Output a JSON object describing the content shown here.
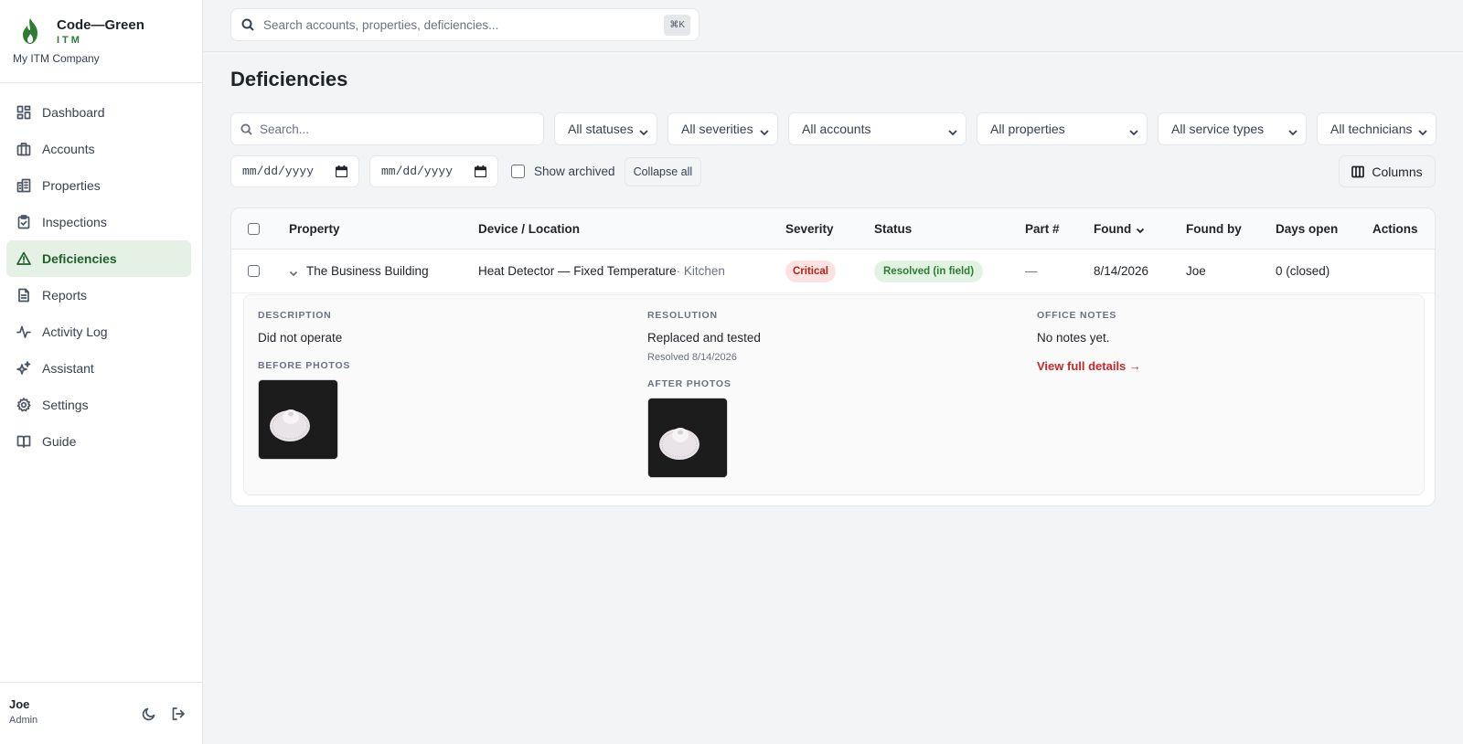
{
  "brand": {
    "name": "Code—Green",
    "sub": "ITM",
    "company": "My ITM Company"
  },
  "nav": [
    {
      "label": "Dashboard",
      "icon": "dashboard-icon"
    },
    {
      "label": "Accounts",
      "icon": "briefcase-icon"
    },
    {
      "label": "Properties",
      "icon": "building-icon"
    },
    {
      "label": "Inspections",
      "icon": "clipboard-check-icon"
    },
    {
      "label": "Deficiencies",
      "icon": "warning-triangle-icon",
      "active": true
    },
    {
      "label": "Reports",
      "icon": "document-icon"
    },
    {
      "label": "Activity Log",
      "icon": "activity-icon"
    },
    {
      "label": "Assistant",
      "icon": "sparkles-icon"
    },
    {
      "label": "Settings",
      "icon": "gear-icon"
    },
    {
      "label": "Guide",
      "icon": "book-icon"
    }
  ],
  "user": {
    "name": "Joe",
    "role": "Admin"
  },
  "topbar": {
    "search_placeholder": "Search accounts, properties, deficiencies...",
    "shortcut": "⌘K"
  },
  "page": {
    "title": "Deficiencies"
  },
  "filters": {
    "search_placeholder": "Search...",
    "status": "All statuses",
    "severity": "All severities",
    "account": "All accounts",
    "property": "All properties",
    "service_type": "All service types",
    "technician": "All technicians",
    "date_from": "mm/dd/yyyy",
    "date_to": "mm/dd/yyyy",
    "show_archived": "Show archived",
    "collapse_all": "Collapse all",
    "columns": "Columns"
  },
  "table": {
    "headers": {
      "property": "Property",
      "device": "Device / Location",
      "severity": "Severity",
      "status": "Status",
      "part": "Part #",
      "found": "Found",
      "found_by": "Found by",
      "days_open": "Days open",
      "actions": "Actions"
    },
    "rows": [
      {
        "property": "The Business Building",
        "device": "Heat Detector — Fixed Temperature",
        "location": " · Kitchen",
        "severity": "Critical",
        "status": "Resolved (in field)",
        "part": "—",
        "found": "8/14/2026",
        "found_by": "Joe",
        "days_open": "0 (closed)"
      }
    ]
  },
  "detail": {
    "description_label": "Description",
    "description": "Did not operate",
    "before_photos_label": "Before photos",
    "resolution_label": "Resolution",
    "resolution": "Replaced and tested",
    "resolved_on": "Resolved 8/14/2026",
    "after_photos_label": "After photos",
    "office_notes_label": "Office notes",
    "office_notes": "No notes yet.",
    "view_details": "View full details →"
  },
  "colors": {
    "brand_green": "#2e7d32",
    "critical": "#b42318",
    "resolved": "#2e7d32",
    "link": "#c62828"
  }
}
